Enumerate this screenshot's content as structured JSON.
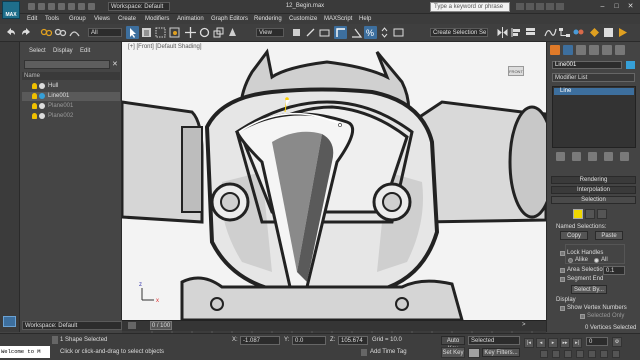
{
  "app": {
    "logo": "MAX",
    "file_title": "12_Begin.max"
  },
  "titlebar": {
    "workspace": "Workspace: Default",
    "search_placeholder": "Type a keyword or phrase"
  },
  "menu": [
    "Edit",
    "Tools",
    "Group",
    "Views",
    "Create",
    "Modifiers",
    "Animation",
    "Graph Editors",
    "Rendering",
    "Customize",
    "MAXScript",
    "Help"
  ],
  "toolbar": {
    "filter": "All",
    "coord_system": "View",
    "named_selection": "Create Selection Se"
  },
  "scene_explorer": {
    "tabs": [
      "Select",
      "Display",
      "Edit"
    ],
    "column": "Name",
    "items": [
      {
        "label": "Hull"
      },
      {
        "label": "Line001"
      },
      {
        "label": "Plane001"
      },
      {
        "label": "Plane002"
      }
    ],
    "workspace": "Workspace: Default"
  },
  "viewport": {
    "label": "[+] [Front] [Default Shading]",
    "view_cube": "FRONT"
  },
  "command_panel": {
    "object_name": "Line001",
    "object_color": "#36a0d8",
    "modifier_list": "Modifier List",
    "stack_item": "Line",
    "rollouts": {
      "rendering": "Rendering",
      "interpolation": "Interpolation",
      "selection": "Selection"
    },
    "named_selections": "Named Selections:",
    "copy": "Copy",
    "paste": "Paste",
    "by_vertex_alike": "Alike",
    "by_vertex_all": "All",
    "lock_handles": "Lock Handles",
    "area_selection": "Area Selection:",
    "area_value": "0.1",
    "segment_end": "Segment End",
    "select_by": "Select By...",
    "display": "Display",
    "show_vertex_numbers": "Show Vertex Numbers",
    "selected_only": "Selected Only",
    "vertices_selected": "0 Vertices Selected"
  },
  "timeline": {
    "frame": "0 / 100",
    "ticks": [
      "0",
      "5",
      "10",
      "15",
      "20",
      "25",
      "30",
      "35",
      "40",
      "45",
      "50",
      "55",
      "60",
      "65",
      "70",
      "75",
      "80",
      "85",
      "90",
      "95",
      "100"
    ]
  },
  "status": {
    "maxscript": "Welcome to M",
    "selection": "1 Shape Selected",
    "prompt": "Click or click-and-drag to select objects",
    "x_label": "X:",
    "x": "-1.087",
    "y_label": "Y:",
    "y": "0.0",
    "z_label": "Z:",
    "z": "105.674",
    "grid": "Grid = 10.0",
    "add_time_tag": "Add Time Tag",
    "auto_key": "Auto Key",
    "set_key": "Set Key",
    "key_mode": "Selected",
    "key_filters": "Key Filters...",
    "frame_value": "0"
  },
  "colors": {
    "accent": "#36a0d8",
    "auto_key": "#3a3a3a"
  }
}
